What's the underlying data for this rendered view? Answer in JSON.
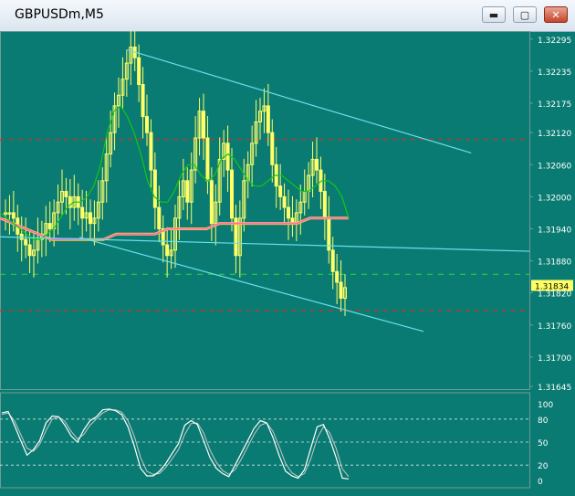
{
  "window": {
    "title": "GBPUSDm,M5",
    "buttons": {
      "minimize": "▬",
      "restore": "▢",
      "close": "✕"
    }
  },
  "colors": {
    "background": "#0a7b72",
    "grid": "#6f9c97",
    "candle": "#ffff66",
    "channel": "#66e0ee",
    "ma_fast": "#11c811",
    "ma_slow": "#ff66cc",
    "ma_slow_under": "#ffcc33",
    "resistance": "#c8322a",
    "stoch_main": "#ffffff",
    "stoch_signal": "#c8c8c8",
    "price_tag_bg": "#ffff66"
  },
  "chart_data": {
    "type": "candlestick",
    "symbol": "GBPUSDm",
    "timeframe": "M5",
    "price_axis": {
      "ticks": [
        1.32295,
        1.32235,
        1.32175,
        1.3212,
        1.3206,
        1.32,
        1.3194,
        1.3188,
        1.3182,
        1.3176,
        1.317,
        1.31645
      ],
      "min": 1.3164,
      "max": 1.3231
    },
    "current_price": "1.31834",
    "bid_level": 1.31855,
    "resistance_levels": [
      1.32107,
      1.31787
    ],
    "channel_lines": [
      {
        "x1": 0.24,
        "y1": 1.32275,
        "x2": 0.89,
        "y2": 1.32082
      },
      {
        "x1": 0.15,
        "y1": 1.31924,
        "x2": 0.8,
        "y2": 1.31748
      },
      {
        "x1": 0.0,
        "y1": 1.31925,
        "x2": 1.0,
        "y2": 1.31898
      }
    ],
    "closes": [
      1.3197,
      1.3197,
      1.3196,
      1.3193,
      1.3192,
      1.3191,
      1.3189,
      1.319,
      1.3192,
      1.3193,
      1.3195,
      1.3194,
      1.3197,
      1.3199,
      1.3201,
      1.32,
      1.3198,
      1.32,
      1.3198,
      1.3196,
      1.3197,
      1.3195,
      1.3196,
      1.3199,
      1.3203,
      1.3208,
      1.3212,
      1.3217,
      1.3219,
      1.3222,
      1.3225,
      1.3228,
      1.3226,
      1.3221,
      1.3215,
      1.3212,
      1.3205,
      1.3198,
      1.3194,
      1.3191,
      1.3189,
      1.319,
      1.3196,
      1.32,
      1.3203,
      1.3199,
      1.3205,
      1.3211,
      1.3216,
      1.3211,
      1.3203,
      1.3195,
      1.3199,
      1.3207,
      1.321,
      1.3205,
      1.3196,
      1.3189,
      1.3196,
      1.3203,
      1.3206,
      1.321,
      1.3214,
      1.3216,
      1.3217,
      1.3212,
      1.3206,
      1.3202,
      1.32,
      1.3198,
      1.3196,
      1.3195,
      1.3197,
      1.3199,
      1.3201,
      1.3204,
      1.3207,
      1.3205,
      1.3201,
      1.3196,
      1.319,
      1.3186,
      1.3184,
      1.3181,
      1.3183
    ],
    "ma_fast": [
      1.3197,
      1.3196,
      1.3195,
      1.3194,
      1.3193,
      1.3192,
      1.3192,
      1.3193,
      1.3194,
      1.3196,
      1.3198,
      1.3199,
      1.3199,
      1.32,
      1.3202,
      1.3206,
      1.3212,
      1.3216,
      1.3217,
      1.3215,
      1.3212,
      1.3208,
      1.3203,
      1.32,
      1.3199,
      1.3199,
      1.3201,
      1.3204,
      1.3206,
      1.3206,
      1.3204,
      1.3203,
      1.3204,
      1.3207,
      1.3208,
      1.3207,
      1.3205,
      1.3203,
      1.3202,
      1.3202,
      1.3203,
      1.3204,
      1.3204,
      1.3203,
      1.3202,
      1.3201,
      1.3201,
      1.3202,
      1.3203,
      1.3203,
      1.3202,
      1.32,
      1.3196
    ],
    "ma_slow": [
      1.3196,
      1.3195,
      1.3194,
      1.3193,
      1.3192,
      1.3192,
      1.3192,
      1.3192,
      1.3192,
      1.3193,
      1.3193,
      1.3193,
      1.3193,
      1.3194,
      1.3194,
      1.3194,
      1.3194,
      1.3195,
      1.3195,
      1.3195,
      1.3195,
      1.3195,
      1.3195,
      1.3195,
      1.3196,
      1.3196,
      1.3196,
      1.3196
    ],
    "stochastic": {
      "levels": [
        80,
        50,
        20
      ],
      "ticks": [
        100,
        80,
        50,
        20,
        0
      ],
      "main": [
        88,
        90,
        72,
        52,
        33,
        40,
        52,
        75,
        84,
        83,
        72,
        58,
        50,
        66,
        78,
        83,
        92,
        93,
        91,
        86,
        70,
        45,
        16,
        6,
        6,
        12,
        22,
        35,
        48,
        72,
        78,
        73,
        52,
        30,
        16,
        9,
        5,
        20,
        36,
        52,
        68,
        78,
        75,
        56,
        32,
        12,
        6,
        3,
        14,
        42,
        70,
        73,
        54,
        30,
        3,
        2
      ],
      "signal": [
        86,
        88,
        78,
        60,
        42,
        38,
        47,
        65,
        80,
        83,
        77,
        64,
        54,
        60,
        72,
        80,
        88,
        92,
        92,
        89,
        78,
        58,
        30,
        12,
        8,
        9,
        17,
        28,
        40,
        60,
        74,
        75,
        62,
        40,
        24,
        13,
        8,
        14,
        28,
        44,
        60,
        72,
        75,
        64,
        44,
        22,
        10,
        5,
        9,
        28,
        55,
        70,
        62,
        42,
        15,
        5
      ]
    }
  }
}
